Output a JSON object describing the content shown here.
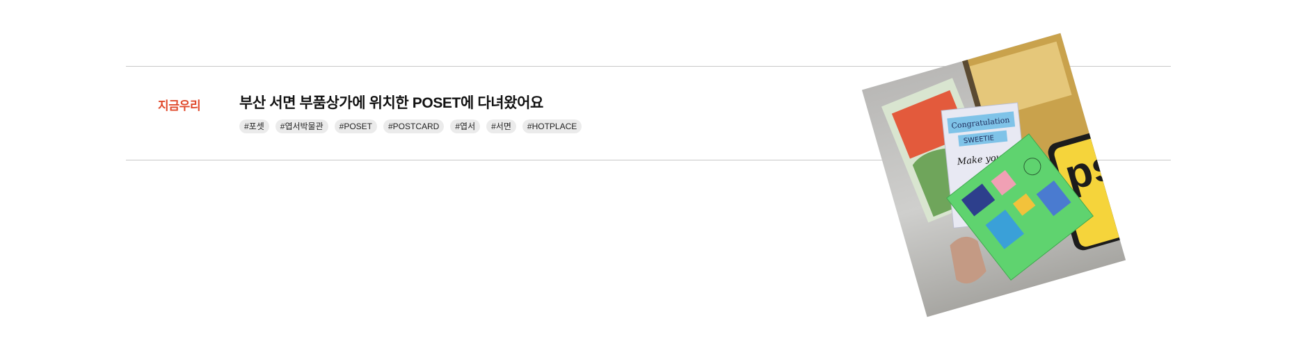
{
  "post": {
    "category": "지금우리",
    "title": "부산 서면 부품상가에 위치한 POSET에 다녀왔어요",
    "tags": [
      "#포셋",
      "#엽서박물관",
      "#POSET",
      "#POSTCARD",
      "#엽서",
      "#서면",
      "#HOTPLACE"
    ],
    "thumbnail": {
      "card_text_1": "Congratulation",
      "card_text_2": "SWEETIE",
      "handwriting": "Make your day",
      "sign_letters": "ps"
    }
  },
  "colors": {
    "category": "#e0492b",
    "title": "#111111",
    "tag_bg": "#ebebeb",
    "divider": "#c8c8c8",
    "sign_yellow": "#f5d43b",
    "card_green": "#5fd36f"
  }
}
